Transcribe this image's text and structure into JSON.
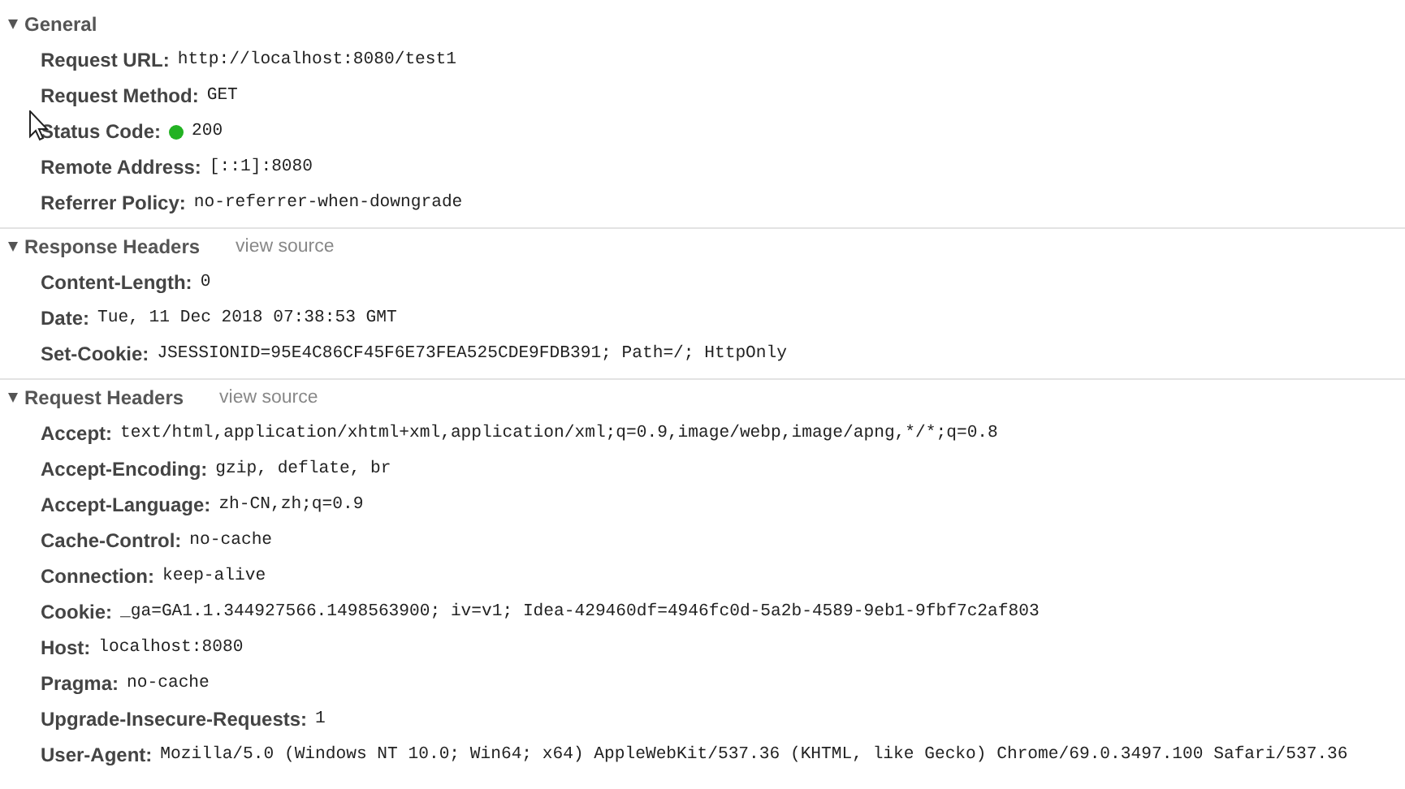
{
  "sections": [
    {
      "title": "General",
      "expanded": true,
      "rows": [
        {
          "name": "Request URL:",
          "value": "http://localhost:8080/test1"
        },
        {
          "name": "Request Method:",
          "value": "GET"
        },
        {
          "name": "Status Code:",
          "value": "200",
          "color": "#22b222"
        },
        {
          "name": "Remote Address:",
          "value": "[::1]:8080"
        },
        {
          "name": "Referrer Policy:",
          "value": "no-referrer-when-downgrade"
        }
      ]
    },
    {
      "title": "Response Headers",
      "link": "view source",
      "expanded": true,
      "rows": [
        {
          "name": "Content-Length:",
          "value": "0"
        },
        {
          "name": "Date:",
          "value": "Tue, 11 Dec 2018 07:38:53 GMT"
        },
        {
          "name": "Set-Cookie:",
          "value": "JSESSIONID=95E4C86CF45F6E73FEA525CDE9FDB391; Path=/; HttpOnly"
        }
      ]
    },
    {
      "title": "Request Headers",
      "link": "view source",
      "expanded": true,
      "rows": [
        {
          "name": "Accept:",
          "value": "text/html,application/xhtml+xml,application/xml;q=0.9,image/webp,image/apng,*/*;q=0.8"
        },
        {
          "name": "Accept-Encoding:",
          "value": "gzip, deflate, br"
        },
        {
          "name": "Accept-Language:",
          "value": "zh-CN,zh;q=0.9"
        },
        {
          "name": "Cache-Control:",
          "value": "no-cache"
        },
        {
          "name": "Connection:",
          "value": "keep-alive"
        },
        {
          "name": "Cookie:",
          "value": "_ga=GA1.1.344927566.1498563900; iv=v1; Idea-429460df=4946fc0d-5a2b-4589-9eb1-9fbf7c2af803"
        },
        {
          "name": "Host:",
          "value": "localhost:8080"
        },
        {
          "name": "Pragma:",
          "value": "no-cache"
        },
        {
          "name": "Upgrade-Insecure-Requests:",
          "value": "1"
        },
        {
          "name": "User-Agent:",
          "value": "Mozilla/5.0 (Windows NT 10.0; Win64; x64) AppleWebKit/537.36 (KHTML, like Gecko) Chrome/69.0.3497.100 Safari/537.36"
        }
      ]
    }
  ]
}
